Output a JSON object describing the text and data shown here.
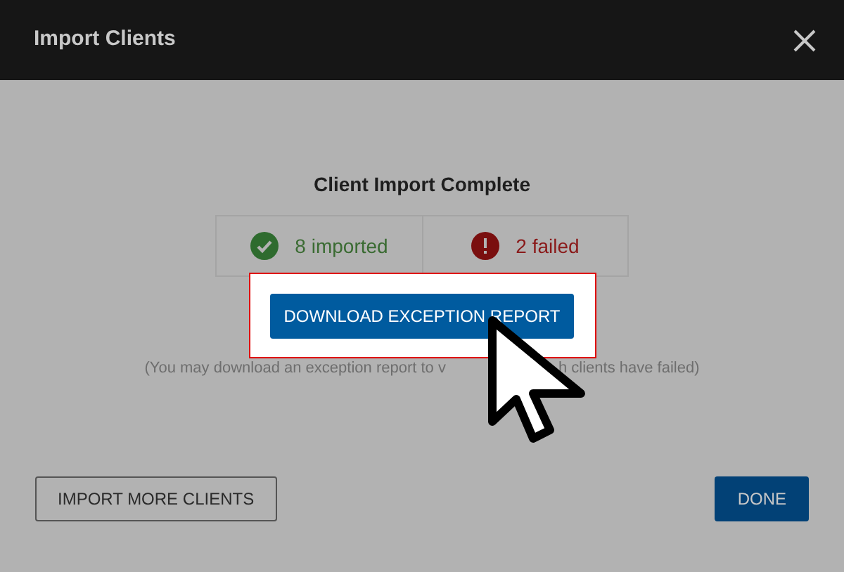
{
  "dialog": {
    "title": "Import Clients"
  },
  "result": {
    "heading": "Client Import Complete",
    "stats": [
      {
        "kind": "success",
        "label": "8 imported"
      },
      {
        "kind": "error",
        "label": "2 failed"
      }
    ]
  },
  "download_button": "DOWNLOAD EXCEPTION REPORT",
  "hint": {
    "before": "(You may download an exception report to v",
    "after": "h clients have failed)"
  },
  "footer": {
    "secondary_button": "IMPORT MORE CLIENTS",
    "primary_button": "DONE"
  }
}
